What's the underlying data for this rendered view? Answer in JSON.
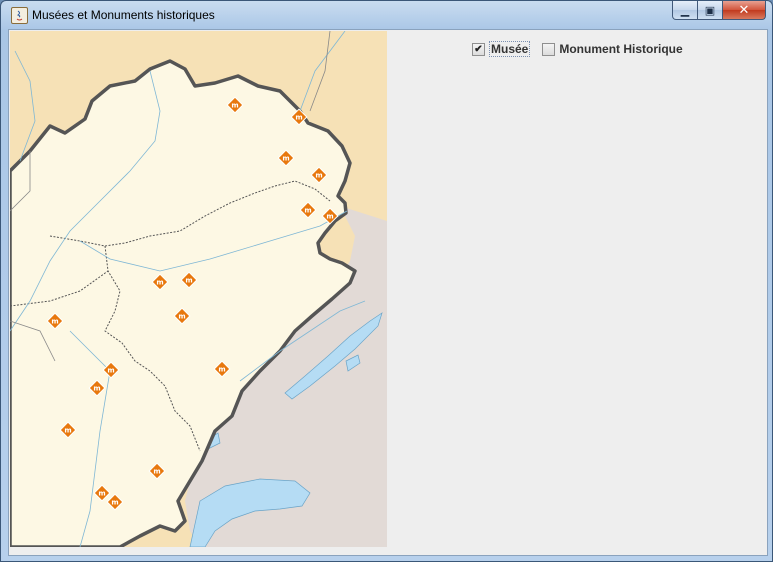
{
  "window": {
    "title": "Musées et Monuments historiques"
  },
  "controls": {
    "musee": {
      "label": "Musée",
      "checked": true
    },
    "monument": {
      "label": "Monument Historique",
      "checked": false
    }
  },
  "map": {
    "colors": {
      "region": "#fdf8e4",
      "outside": "#f6e1b6",
      "switzerland": "#e2dad6",
      "water": "#b5dcf4",
      "marker": "#e8780d",
      "border": "#555555"
    },
    "marker_glyph": "m"
  }
}
